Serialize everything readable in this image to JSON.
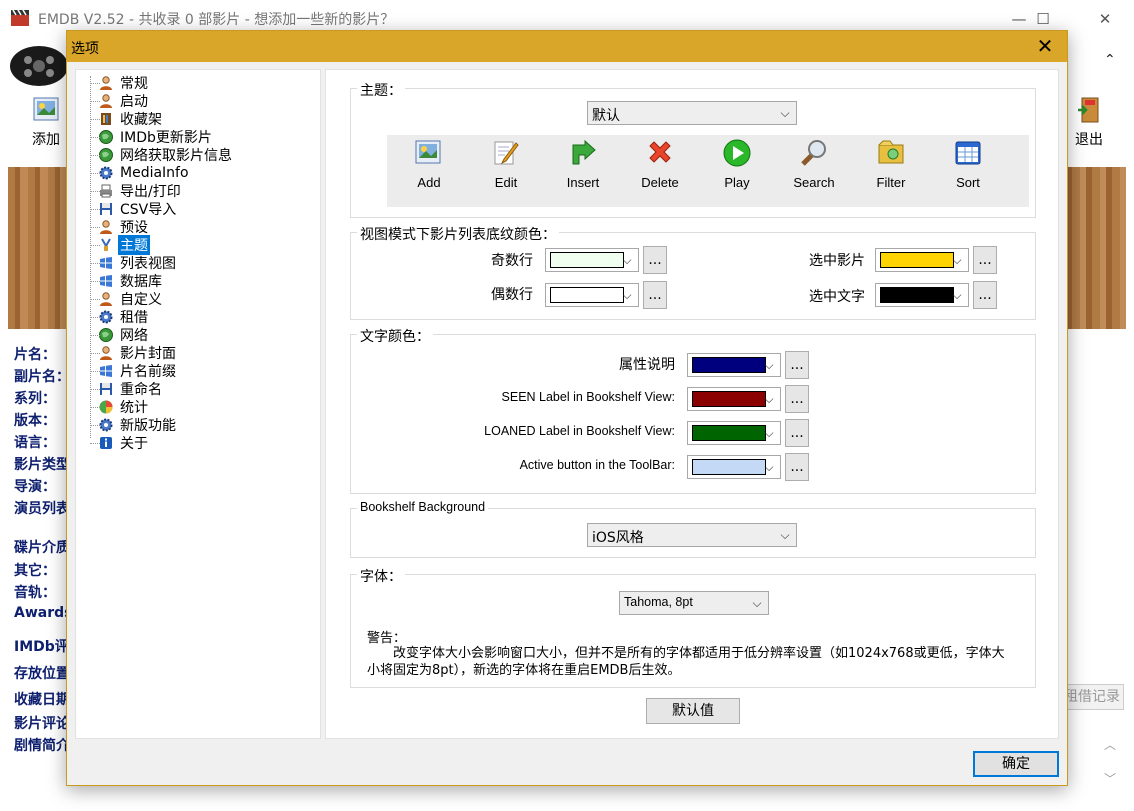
{
  "main_window": {
    "title": "EMDB V2.52 - 共收录 0 部影片 - 想添加一些新的影片？",
    "toolbar": {
      "add_label": "添加",
      "exit_label": "退出"
    },
    "fields": [
      "片名：",
      "副片名：",
      "系列：",
      "版本：",
      "语言：",
      "影片类型",
      "导演：",
      "演员列表",
      "碟片介质",
      "其它：",
      "音轨：",
      "Awards:",
      "IMDb评分",
      "存放位置",
      "收藏日期",
      "影片评论",
      "剧情简介"
    ],
    "loan_record_label": "租借记录"
  },
  "dialog": {
    "title": "选项",
    "tree": [
      {
        "label": "常规",
        "icon": "person-icon"
      },
      {
        "label": "启动",
        "icon": "person-icon"
      },
      {
        "label": "收藏架",
        "icon": "bookshelf-icon"
      },
      {
        "label": "IMDb更新影片",
        "icon": "globe-icon"
      },
      {
        "label": "网络获取影片信息",
        "icon": "globe-icon"
      },
      {
        "label": "MediaInfo",
        "icon": "gear-icon"
      },
      {
        "label": "导出/打印",
        "icon": "printer-icon"
      },
      {
        "label": "CSV导入",
        "icon": "disk-icon"
      },
      {
        "label": "预设",
        "icon": "person-icon"
      },
      {
        "label": "主题",
        "icon": "brush-icon",
        "selected": true
      },
      {
        "label": "列表视图",
        "icon": "windows-icon"
      },
      {
        "label": "数据库",
        "icon": "windows-icon"
      },
      {
        "label": "自定义",
        "icon": "person-icon"
      },
      {
        "label": "租借",
        "icon": "gear-icon"
      },
      {
        "label": "网络",
        "icon": "globe-icon"
      },
      {
        "label": "影片封面",
        "icon": "person-icon"
      },
      {
        "label": "片名前缀",
        "icon": "windows-icon"
      },
      {
        "label": "重命名",
        "icon": "disk-icon"
      },
      {
        "label": "统计",
        "icon": "chart-icon"
      },
      {
        "label": "新版功能",
        "icon": "gear-icon"
      },
      {
        "label": "关于",
        "icon": "info-icon"
      }
    ],
    "theme": {
      "title": "主题：",
      "selected": "默认",
      "buttons": [
        {
          "label": "Add",
          "icon": "add-picture-icon"
        },
        {
          "label": "Edit",
          "icon": "edit-icon"
        },
        {
          "label": "Insert",
          "icon": "insert-arrow-icon"
        },
        {
          "label": "Delete",
          "icon": "delete-x-icon"
        },
        {
          "label": "Play",
          "icon": "play-icon"
        },
        {
          "label": "Search",
          "icon": "search-icon"
        },
        {
          "label": "Filter",
          "icon": "filter-icon"
        },
        {
          "label": "Sort",
          "icon": "sort-icon"
        }
      ]
    },
    "stripe_colors": {
      "title": "视图模式下影片列表底纹颜色：",
      "odd_label": "奇数行",
      "odd_color": "#f0fff0",
      "even_label": "偶数行",
      "even_color": "#ffffff",
      "selected_movie_label": "选中影片",
      "selected_movie_color": "#ffd400",
      "selected_text_label": "选中文字",
      "selected_text_color": "#000000",
      "dots": "..."
    },
    "text_colors": {
      "title": "文字颜色：",
      "rows": [
        {
          "label": "属性说明",
          "color": "#00007f"
        },
        {
          "label": "SEEN Label in Bookshelf View:",
          "color": "#8b0000"
        },
        {
          "label": "LOANED Label in Bookshelf View:",
          "color": "#006400"
        },
        {
          "label": "Active button in the ToolBar:",
          "color": "#c4d9f5"
        }
      ]
    },
    "bookshelf": {
      "title": "Bookshelf Background",
      "selected": "iOS风格"
    },
    "font": {
      "title": "字体：",
      "selected": "Tahoma,  8pt",
      "warning_title": "警告：",
      "warning_text": "改变字体大小会影响窗口大小，但并不是所有的字体都适用于低分辨率设置（如1024x768或更低，字体大小将固定为8pt），新选的字体将在重启EMDB后生效。"
    },
    "default_button": "默认值",
    "ok_button": "确定"
  }
}
